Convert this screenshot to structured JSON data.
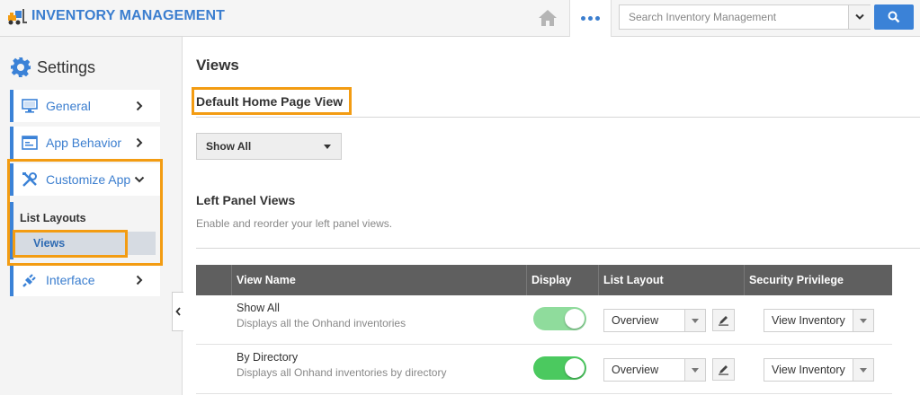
{
  "header": {
    "app_title": "INVENTORY MANAGEMENT",
    "search_placeholder": "Search Inventory Management"
  },
  "sidebar": {
    "title": "Settings",
    "items": [
      {
        "label": "General"
      },
      {
        "label": "App Behavior"
      },
      {
        "label": "Customize App"
      },
      {
        "label": "Interface"
      }
    ],
    "subitems": [
      {
        "label": "List Layouts"
      },
      {
        "label": "Views"
      }
    ]
  },
  "main": {
    "page_title": "Views",
    "default_home": {
      "title": "Default Home Page View",
      "selected": "Show All"
    },
    "left_panel": {
      "title": "Left Panel Views",
      "description": "Enable and reorder your left panel views."
    },
    "table": {
      "columns": [
        "View Name",
        "Display",
        "List Layout",
        "Security Privilege"
      ],
      "rows": [
        {
          "name": "Show All",
          "description": "Displays all the Onhand inventories",
          "display": true,
          "display_color": "#8fdc9c",
          "list_layout": "Overview",
          "security": "View Inventory"
        },
        {
          "name": "By Directory",
          "description": "Displays all Onhand inventories by directory",
          "display": true,
          "display_color": "#4bc95f",
          "list_layout": "Overview",
          "security": "View Inventory"
        }
      ]
    }
  },
  "colors": {
    "accent": "#3b82d7",
    "highlight": "#f39c12",
    "table_header": "#5f5f5f"
  }
}
